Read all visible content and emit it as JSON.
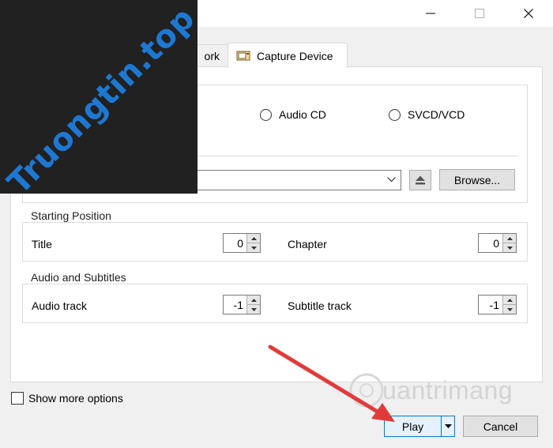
{
  "logo_text": "Truongtin.top",
  "watermark_text": "uantrimang",
  "tabs": {
    "network_partial": "ork",
    "capture_device": "Capture Device"
  },
  "disc": {
    "audio_cd": "Audio CD",
    "svcd_vcd": "SVCD/VCD",
    "browse": "Browse..."
  },
  "starting_position": {
    "title": "Starting Position",
    "title_label": "Title",
    "title_value": "0",
    "chapter_label": "Chapter",
    "chapter_value": "0"
  },
  "audio_subtitles": {
    "title": "Audio and Subtitles",
    "audio_label": "Audio track",
    "audio_value": "-1",
    "subtitle_label": "Subtitle track",
    "subtitle_value": "-1"
  },
  "footer": {
    "show_more": "Show more options",
    "play": "Play",
    "cancel": "Cancel"
  },
  "colors": {
    "accent": "#0078d7",
    "arrow": "#e03b3b",
    "logo_bg": "#212121",
    "logo_text": "#1e78d2"
  }
}
